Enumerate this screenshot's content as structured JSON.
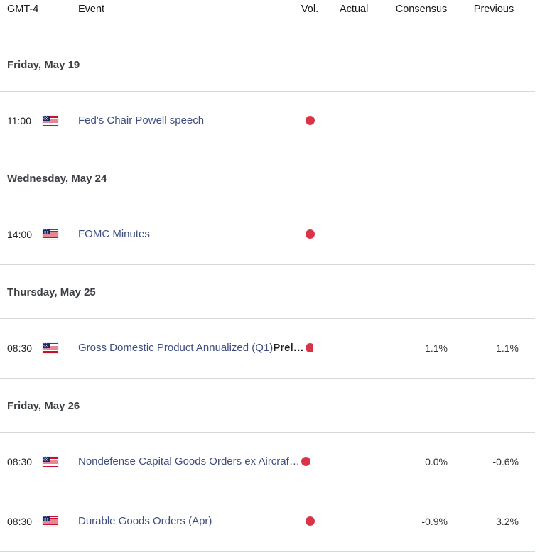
{
  "header": {
    "timezone_label": "GMT-4",
    "event_label": "Event",
    "vol_label": "Vol.",
    "actual_label": "Actual",
    "consensus_label": "Consensus",
    "previous_label": "Previous"
  },
  "colors": {
    "link": "#3f4e80",
    "volatility_high": "#d9334a",
    "divider": "#d6d9dc",
    "date_header": "#3c4044"
  },
  "sections": [
    {
      "date": "Friday, May 19",
      "events": [
        {
          "time": "11:00",
          "country": "united-states",
          "flag": "us-flag-icon",
          "title": "Fed's Chair Powell speech",
          "title_suffix": "",
          "truncated": false,
          "volatility": "high",
          "actual": "",
          "consensus": "",
          "previous": ""
        }
      ]
    },
    {
      "date": "Wednesday, May 24",
      "events": [
        {
          "time": "14:00",
          "country": "united-states",
          "flag": "us-flag-icon",
          "title": "FOMC Minutes",
          "title_suffix": "",
          "truncated": false,
          "volatility": "high",
          "actual": "",
          "consensus": "",
          "previous": ""
        }
      ]
    },
    {
      "date": "Thursday, May 25",
      "events": [
        {
          "time": "08:30",
          "country": "united-states",
          "flag": "us-flag-icon",
          "title": "Gross Domestic Product Annualized (Q1)",
          "title_suffix": "Prel…",
          "truncated": true,
          "volatility": "high",
          "actual": "",
          "consensus": "1.1%",
          "previous": "1.1%"
        }
      ]
    },
    {
      "date": "Friday, May 26",
      "events": [
        {
          "time": "08:30",
          "country": "united-states",
          "flag": "us-flag-icon",
          "title": "Nondefense Capital Goods Orders ex Aircraf…",
          "title_suffix": "",
          "truncated": true,
          "volatility": "high",
          "actual": "",
          "consensus": "0.0%",
          "previous": "-0.6%"
        },
        {
          "time": "08:30",
          "country": "united-states",
          "flag": "us-flag-icon",
          "title": "Durable Goods Orders (Apr)",
          "title_suffix": "",
          "truncated": false,
          "volatility": "high",
          "actual": "",
          "consensus": "-0.9%",
          "previous": "3.2%"
        }
      ]
    }
  ]
}
